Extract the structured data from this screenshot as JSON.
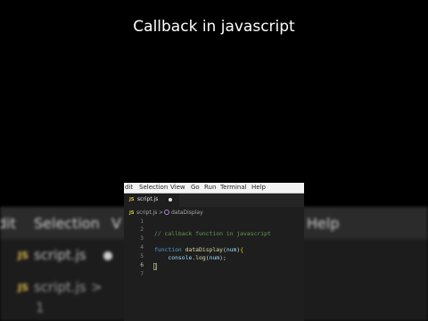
{
  "video_title": "Callback in javascript",
  "menu": [
    "Edit",
    "Selection",
    "View",
    "Go",
    "Run",
    "Terminal",
    "Help"
  ],
  "menu_visible": [
    "dit",
    "Selection",
    "View",
    "Go",
    "Run",
    "Terminal",
    "Help"
  ],
  "background_menu_visible": [
    "dit",
    "Selection",
    "V",
    "Help"
  ],
  "tab": {
    "icon_text": "JS",
    "label": "script.js"
  },
  "breadcrumb": {
    "file": "script.js",
    "separator": ">",
    "symbol": "dataDisplay"
  },
  "line_numbers": [
    "1",
    "2",
    "3",
    "4",
    "5",
    "6",
    "7"
  ],
  "active_line": "6",
  "code": {
    "comment": "// callback function in javascript",
    "keyword": "function",
    "fn_name": "dataDisplay",
    "param": "num",
    "open_paren": "(",
    "close_paren": ")",
    "open_brace": "{",
    "close_brace": "}",
    "indent": "    ",
    "console_obj": "console",
    "dot": ".",
    "log_fn": "log",
    "arg": "num",
    "end_call": ");"
  },
  "colors": {
    "background": "#000000",
    "editor_bg": "#1e1e1e",
    "menubar_bg": "#f3f3f3",
    "js_icon": "#cbcb41",
    "comment": "#6a9955",
    "keyword": "#569cd6",
    "function": "#dcdcaa",
    "variable": "#9cdcfe",
    "bracket": "#ffd700"
  },
  "icons": {
    "tab_icon": "javascript-file-icon",
    "dirty": "unsaved-dot-icon",
    "breadcrumb_symbol": "function-symbol-icon"
  }
}
